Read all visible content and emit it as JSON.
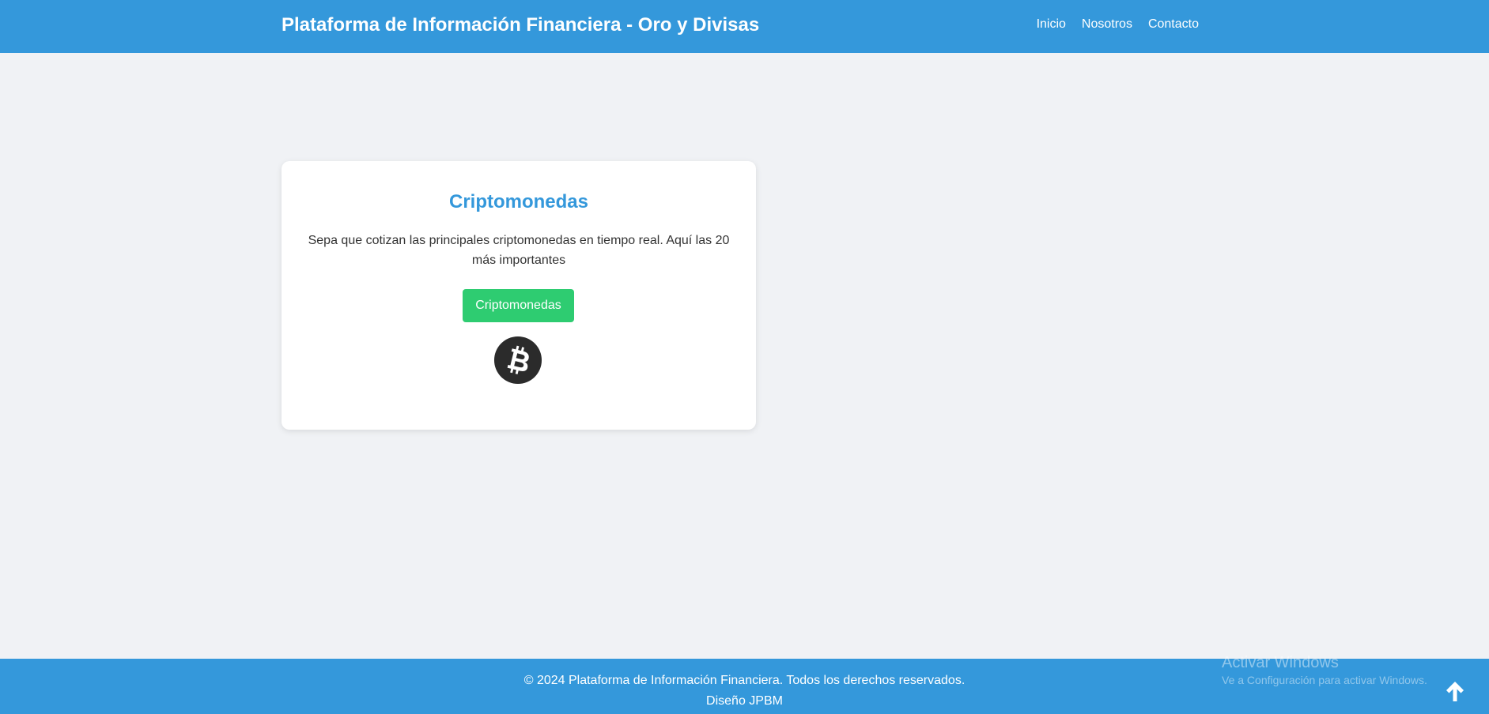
{
  "header": {
    "title": "Plataforma de Información Financiera - Oro y Divisas",
    "nav": [
      "Inicio",
      "Nosotros",
      "Contacto"
    ]
  },
  "card": {
    "title": "Criptomonedas",
    "description": "Sepa que cotizan las principales criptomonedas en tiempo real. Aquí las 20 más importantes",
    "button_label": "Criptomonedas",
    "icon": "bitcoin-icon"
  },
  "footer": {
    "copyright": "© 2024 Plataforma de Información Financiera. Todos los derechos reservados.",
    "design": "Diseño JPBM"
  },
  "watermark": {
    "title": "Activar Windows",
    "subtitle": "Ve a Configuración para activar Windows."
  },
  "scroll_top_icon": "arrow-up-icon",
  "colors": {
    "primary": "#3498db",
    "button": "#2ecc71",
    "background": "#f0f2f5",
    "coin": "#2b2b2b"
  }
}
